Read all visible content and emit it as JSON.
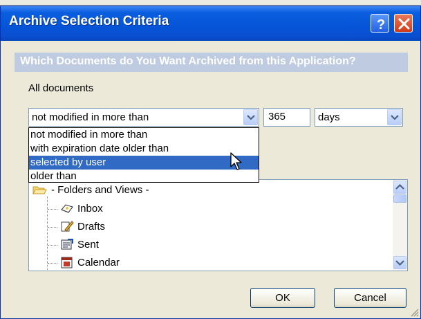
{
  "dialog": {
    "title": "Archive Selection Criteria",
    "help_label": "?",
    "header": "Which Documents do You Want Archived from this Application?",
    "scope_label": "All documents"
  },
  "criteria": {
    "filter_selected": "not modified in more than",
    "days_value": "365",
    "unit_selected": "days",
    "options": [
      "not modified in more than",
      "with expiration date older than",
      "selected by user",
      "older than"
    ],
    "highlighted_option": "selected by user"
  },
  "tree": {
    "root": "- Folders and Views -",
    "items": [
      "Inbox",
      "Drafts",
      "Sent",
      "Calendar"
    ]
  },
  "buttons": {
    "ok": "OK",
    "cancel": "Cancel"
  },
  "colors": {
    "title_bar": "#0654d7",
    "selection": "#316ac5",
    "header_band": "#bfcbe0"
  }
}
